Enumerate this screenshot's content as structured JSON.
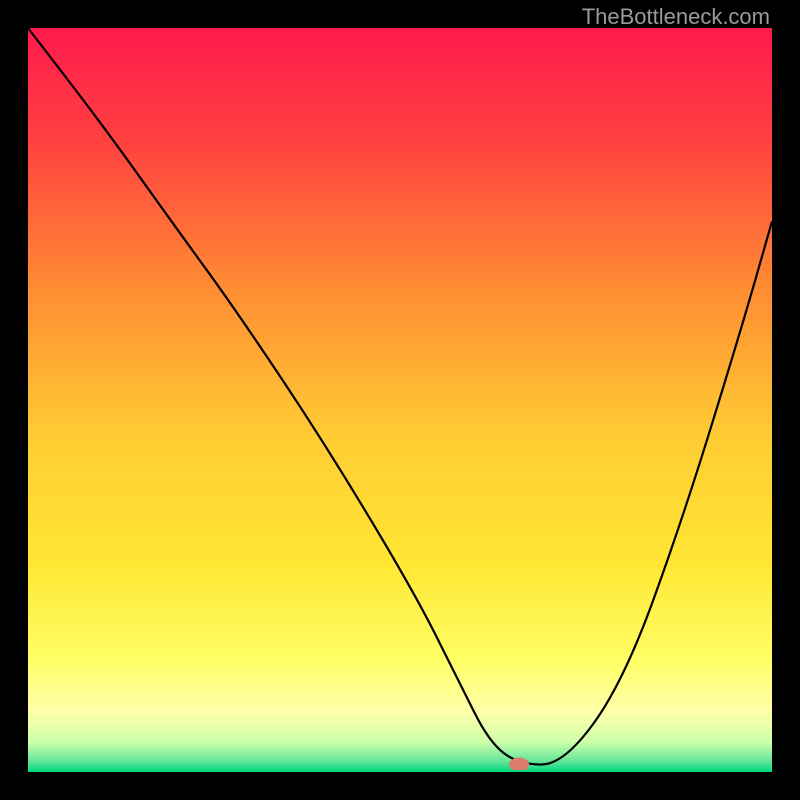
{
  "watermark": "TheBottleneck.com",
  "chart_data": {
    "type": "line",
    "title": "",
    "xlabel": "",
    "ylabel": "",
    "xlim": [
      0,
      100
    ],
    "ylim": [
      0,
      100
    ],
    "background_gradient": {
      "stops": [
        {
          "offset": 0.0,
          "color": "#ff1a4d"
        },
        {
          "offset": 0.15,
          "color": "#ff4040"
        },
        {
          "offset": 0.35,
          "color": "#ff8c33"
        },
        {
          "offset": 0.55,
          "color": "#ffcc33"
        },
        {
          "offset": 0.72,
          "color": "#ffe633"
        },
        {
          "offset": 0.85,
          "color": "#ffff66"
        },
        {
          "offset": 0.92,
          "color": "#ffffaa"
        },
        {
          "offset": 0.96,
          "color": "#ccffaa"
        },
        {
          "offset": 0.985,
          "color": "#66e699"
        },
        {
          "offset": 1.0,
          "color": "#00d97f"
        }
      ]
    },
    "series": [
      {
        "name": "bottleneck-curve",
        "x": [
          0,
          10,
          20,
          28,
          40,
          52,
          58,
          62,
          66,
          72,
          80,
          88,
          96,
          100
        ],
        "y": [
          100,
          87,
          73,
          62,
          44,
          24,
          12,
          4,
          1,
          1,
          12,
          34,
          60,
          74
        ]
      }
    ],
    "marker": {
      "x": 66,
      "y": 1,
      "color": "#e07a6f",
      "rx": 10,
      "ry": 7
    }
  }
}
